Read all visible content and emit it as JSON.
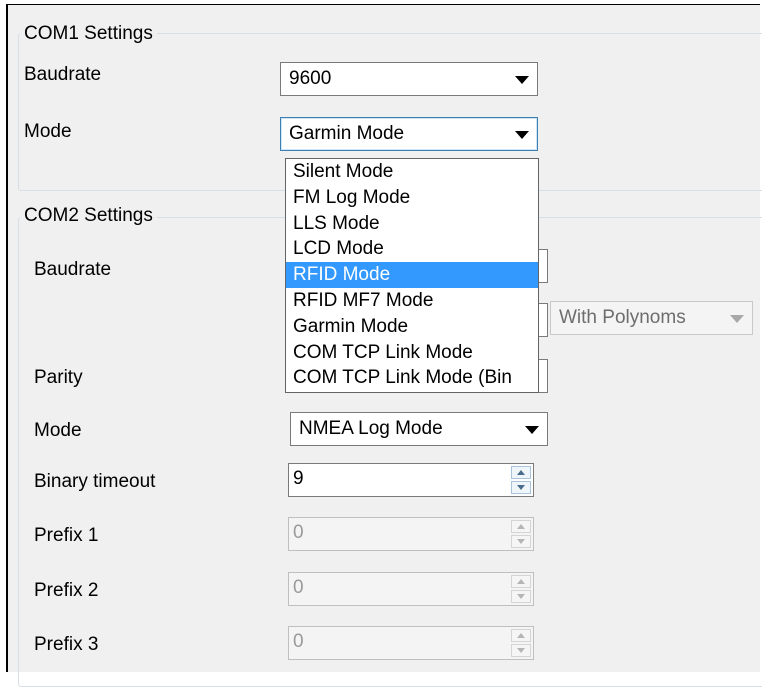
{
  "com1": {
    "title": "COM1 Settings",
    "baudrate_label": "Baudrate",
    "baudrate_value": "9600",
    "mode_label": "Mode",
    "mode_value": "Garmin Mode"
  },
  "dropdown": {
    "items": [
      "Silent Mode",
      "FM Log Mode",
      "LLS Mode",
      "LCD Mode",
      "RFID Mode",
      "RFID MF7 Mode",
      "Garmin Mode",
      "COM TCP Link Mode",
      "COM TCP Link Mode (Bin"
    ],
    "selected_index": 4
  },
  "com2": {
    "title": "COM2 Settings",
    "baudrate_label": "Baudrate",
    "polynoms_value": "With Polynoms",
    "parity_label": "Parity",
    "mode_label": "Mode",
    "mode_value": "NMEA Log Mode",
    "binary_timeout_label": "Binary timeout",
    "binary_timeout_value": "9",
    "prefix1_label": "Prefix 1",
    "prefix1_value": "0",
    "prefix2_label": "Prefix 2",
    "prefix2_value": "0",
    "prefix3_label": "Prefix 3",
    "prefix3_value": "0"
  },
  "colors": {
    "panel": "#f0f0f0",
    "selection": "#3399ff",
    "focus_border": "#3c7fb1"
  }
}
